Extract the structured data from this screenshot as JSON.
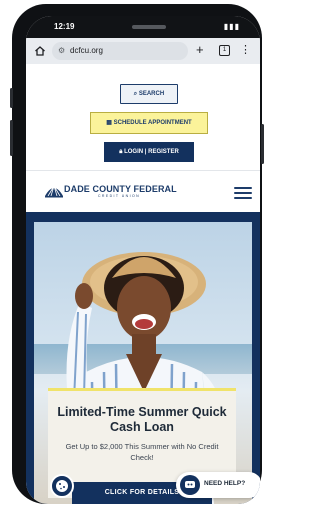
{
  "status_bar": {
    "time": "12:19"
  },
  "browser": {
    "url": "dcfcu.org",
    "tab_count": "1"
  },
  "utility": {
    "search_label": "SEARCH",
    "appointment_label": "SCHEDULE APPOINTMENT",
    "login_label": "LOGIN | REGISTER"
  },
  "header": {
    "logo_name": "DADE COUNTY FEDERAL",
    "logo_sub": "CREDIT UNION"
  },
  "promo": {
    "title": "Limited-Time Summer Quick Cash Loan",
    "text": "Get Up to $2,000 This Summer with No Credit Check!",
    "cta": "CLICK FOR DETAILS"
  },
  "chat": {
    "label": "NEED HELP?"
  },
  "colors": {
    "brand_navy": "#13315e",
    "accent_yellow": "#fbf39a"
  }
}
